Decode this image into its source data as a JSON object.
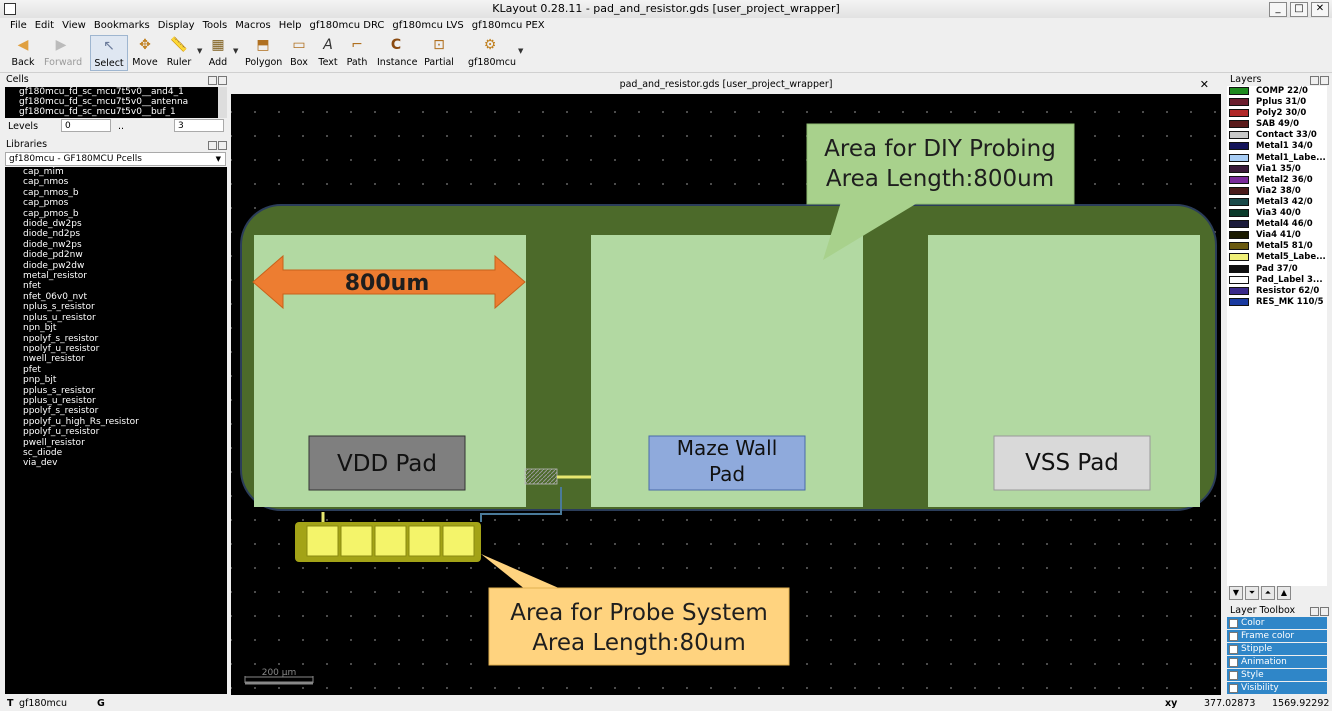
{
  "window": {
    "title": "KLayout 0.28.11 - pad_and_resistor.gds [user_project_wrapper]",
    "minimize": "_",
    "maximize": "□",
    "close": "✕"
  },
  "menu": [
    "File",
    "Edit",
    "View",
    "Bookmarks",
    "Display",
    "Tools",
    "Macros",
    "Help",
    "gf180mcu DRC",
    "gf180mcu LVS",
    "gf180mcu PEX"
  ],
  "toolbar": {
    "back": "Back",
    "forward": "Forward",
    "select": "Select",
    "move": "Move",
    "ruler": "Ruler",
    "add": "Add",
    "polygon": "Polygon",
    "box": "Box",
    "text": "Text",
    "path": "Path",
    "instance": "Instance",
    "partial": "Partial",
    "pdk": "gf180mcu"
  },
  "cells": {
    "header": "Cells",
    "items": [
      "gf180mcu_fd_sc_mcu7t5v0__and4_1",
      "gf180mcu_fd_sc_mcu7t5v0__antenna",
      "gf180mcu_fd_sc_mcu7t5v0__buf_1"
    ],
    "levels_label": "Levels",
    "levels_from": "0",
    "levels_sep": "..",
    "levels_to": "3"
  },
  "libraries": {
    "header": "Libraries",
    "selected": "gf180mcu - GF180MCU Pcells",
    "items": [
      "cap_mim",
      "cap_nmos",
      "cap_nmos_b",
      "cap_pmos",
      "cap_pmos_b",
      "diode_dw2ps",
      "diode_nd2ps",
      "diode_nw2ps",
      "diode_pd2nw",
      "diode_pw2dw",
      "metal_resistor",
      "nfet",
      "nfet_06v0_nvt",
      "nplus_s_resistor",
      "nplus_u_resistor",
      "npn_bjt",
      "npolyf_s_resistor",
      "npolyf_u_resistor",
      "nwell_resistor",
      "pfet",
      "pnp_bjt",
      "pplus_s_resistor",
      "pplus_u_resistor",
      "ppolyf_s_resistor",
      "ppolyf_u_high_Rs_resistor",
      "ppolyf_u_resistor",
      "pwell_resistor",
      "sc_diode",
      "via_dev"
    ]
  },
  "canvas": {
    "tab_title": "pad_and_resistor.gds [user_project_wrapper]",
    "close": "✕",
    "scale": "200 µm",
    "annotations": {
      "diy_line1": "Area for DIY Probing",
      "diy_line2": "Area Length:800um",
      "probe_line1": "Area for Probe System",
      "probe_line2": "Area Length:80um",
      "width_label": "800um",
      "vdd_pad": "VDD Pad",
      "maze_line1": "Maze Wall",
      "maze_line2": "Pad",
      "vss_pad": "VSS Pad"
    }
  },
  "layers": {
    "header": "Layers",
    "items": [
      {
        "name": "COMP 22/0",
        "color": "#1e8a1e"
      },
      {
        "name": "Pplus 31/0",
        "color": "#6b1e2e"
      },
      {
        "name": "Poly2 30/0",
        "color": "#b02828"
      },
      {
        "name": "SAB 49/0",
        "color": "#5a1a1a"
      },
      {
        "name": "Contact 33/0",
        "color": "#c8c8c8"
      },
      {
        "name": "Metal1 34/0",
        "color": "#14145a"
      },
      {
        "name": "Metal1_Labe...",
        "color": "#a8cdf5"
      },
      {
        "name": "Via1 35/0",
        "color": "#3a1a3a"
      },
      {
        "name": "Metal2 36/0",
        "color": "#7a2a9a"
      },
      {
        "name": "Via2 38/0",
        "color": "#4a1a1a"
      },
      {
        "name": "Metal3 42/0",
        "color": "#1a4a4a"
      },
      {
        "name": "Via3 40/0",
        "color": "#0a3a2a"
      },
      {
        "name": "Metal4 46/0",
        "color": "#1a1a3a"
      },
      {
        "name": "Via4 41/0",
        "color": "#1a1a00"
      },
      {
        "name": "Metal5 81/0",
        "color": "#6a5a10"
      },
      {
        "name": "Metal5_Labe...",
        "color": "#f0f078"
      },
      {
        "name": "Pad 37/0",
        "color": "#101010"
      },
      {
        "name": "Pad_Label 3...",
        "color": "#ffffff"
      },
      {
        "name": "Resistor 62/0",
        "color": "#3a2a8a"
      },
      {
        "name": "RES_MK 110/5",
        "color": "#1a3aa0"
      }
    ]
  },
  "layer_toolbox": {
    "header": "Layer Toolbox",
    "items": [
      "Color",
      "Frame color",
      "Stipple",
      "Animation",
      "Style",
      "Visibility"
    ]
  },
  "status": {
    "tech": "T",
    "tech_name": "gf180mcu",
    "grid": "G",
    "coord_label": "xy",
    "x": "377.02873",
    "y": "1569.92292"
  }
}
